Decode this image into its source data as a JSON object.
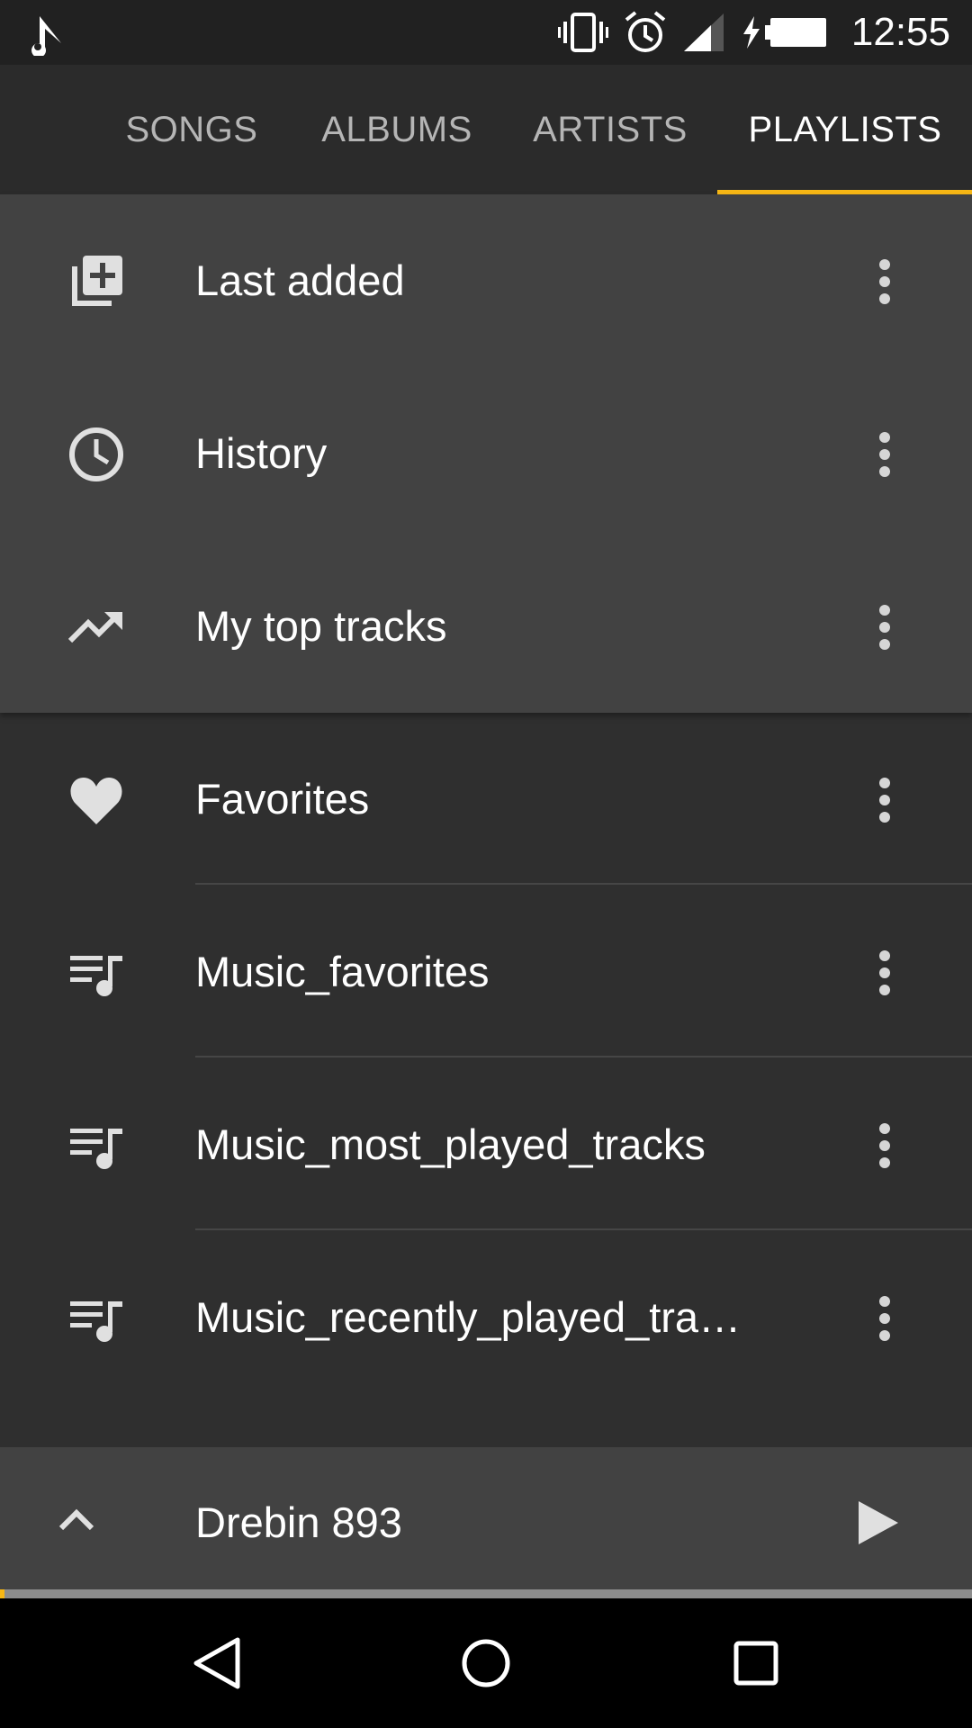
{
  "status_bar": {
    "time": "12:55",
    "icons": [
      "app-notification-icon",
      "vibrate-icon",
      "alarm-icon",
      "cell-signal-icon",
      "battery-charging-icon"
    ]
  },
  "tabs": [
    {
      "label": "SONGS",
      "active": false
    },
    {
      "label": "ALBUMS",
      "active": false
    },
    {
      "label": "ARTISTS",
      "active": false
    },
    {
      "label": "PLAYLISTS",
      "active": true
    }
  ],
  "smart_playlists": [
    {
      "title": "Last added",
      "icon": "library-add-icon"
    },
    {
      "title": "History",
      "icon": "clock-icon"
    },
    {
      "title": "My top tracks",
      "icon": "trending-up-icon"
    }
  ],
  "playlists": [
    {
      "title": "Favorites",
      "icon": "heart-icon"
    },
    {
      "title": "Music_favorites",
      "icon": "playlist-music-icon"
    },
    {
      "title": "Music_most_played_tracks",
      "icon": "playlist-music-icon"
    },
    {
      "title": "Music_recently_played_trac…",
      "icon": "playlist-music-icon"
    }
  ],
  "mini_player": {
    "track": "Drebin 893",
    "progress_fraction": 0.005
  },
  "colors": {
    "accent": "#f7b715",
    "tab_bar": "#2b2b2b",
    "smart_group": "#424242",
    "list_bg": "#2f2f2f"
  }
}
